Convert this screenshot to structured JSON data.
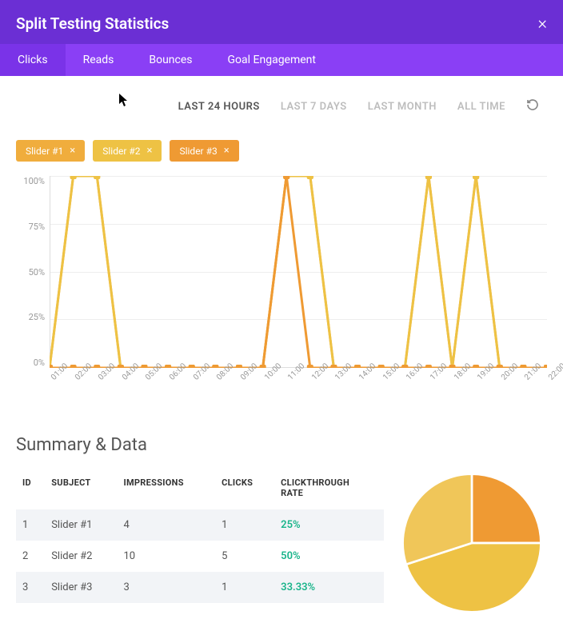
{
  "header": {
    "title": "Split Testing Statistics",
    "close": "×"
  },
  "tabs": [
    {
      "label": "Clicks",
      "active": true
    },
    {
      "label": "Reads",
      "active": false
    },
    {
      "label": "Bounces",
      "active": false
    },
    {
      "label": "Goal Engagement",
      "active": false
    }
  ],
  "time_nav": [
    {
      "label": "LAST 24 HOURS",
      "active": true
    },
    {
      "label": "LAST 7 DAYS",
      "active": false
    },
    {
      "label": "LAST MONTH",
      "active": false
    },
    {
      "label": "ALL TIME",
      "active": false
    }
  ],
  "sliders": [
    {
      "label": "Slider #1",
      "color": "#f0ad3d"
    },
    {
      "label": "Slider #2",
      "color": "#eec244"
    },
    {
      "label": "Slider #3",
      "color": "#ef9a33"
    }
  ],
  "summary_title": "Summary & Data",
  "table": {
    "headers": [
      "ID",
      "SUBJECT",
      "IMPRESSIONS",
      "CLICKS",
      "CLICKTHROUGH RATE"
    ],
    "rows": [
      {
        "id": "1",
        "subject": "Slider #1",
        "impressions": "4",
        "clicks": "1",
        "ctr": "25%"
      },
      {
        "id": "2",
        "subject": "Slider #2",
        "impressions": "10",
        "clicks": "5",
        "ctr": "50%"
      },
      {
        "id": "3",
        "subject": "Slider #3",
        "impressions": "3",
        "clicks": "1",
        "ctr": "33.33%"
      }
    ]
  },
  "chart_data": {
    "type": "line",
    "title": "",
    "ylabel": "",
    "ylim": [
      0,
      100
    ],
    "y_ticks": [
      "100%",
      "75%",
      "50%",
      "25%",
      "0%"
    ],
    "x": [
      "01:00",
      "02:00",
      "03:00",
      "04:00",
      "05:00",
      "06:00",
      "07:00",
      "08:00",
      "09:00",
      "10:00",
      "11:00",
      "12:00",
      "13:00",
      "14:00",
      "15:00",
      "16:00",
      "17:00",
      "18:00",
      "19:00",
      "20:00",
      "21:00",
      "22:00"
    ],
    "series": [
      {
        "name": "Slider #1",
        "color": "#f0ad3d",
        "values": [
          0,
          100,
          100,
          0,
          0,
          0,
          0,
          0,
          0,
          0,
          100,
          100,
          0,
          0,
          0,
          0,
          100,
          0,
          100,
          0,
          0,
          0
        ]
      },
      {
        "name": "Slider #2",
        "color": "#eec244",
        "values": [
          0,
          100,
          100,
          0,
          0,
          0,
          0,
          0,
          0,
          0,
          100,
          100,
          0,
          0,
          0,
          0,
          100,
          0,
          100,
          0,
          0,
          0
        ]
      },
      {
        "name": "Slider #3",
        "color": "#ef9a33",
        "values": [
          0,
          0,
          0,
          0,
          0,
          0,
          0,
          0,
          0,
          0,
          100,
          0,
          0,
          0,
          0,
          0,
          0,
          0,
          0,
          0,
          0,
          0
        ]
      }
    ]
  },
  "pie_data": {
    "type": "pie",
    "slices": [
      {
        "name": "Slider #3",
        "value": 25,
        "color": "#ef9a33"
      },
      {
        "name": "Slider #2",
        "value": 45,
        "color": "#eec244"
      },
      {
        "name": "Slider #1",
        "value": 30,
        "color": "#f0c659"
      }
    ]
  }
}
